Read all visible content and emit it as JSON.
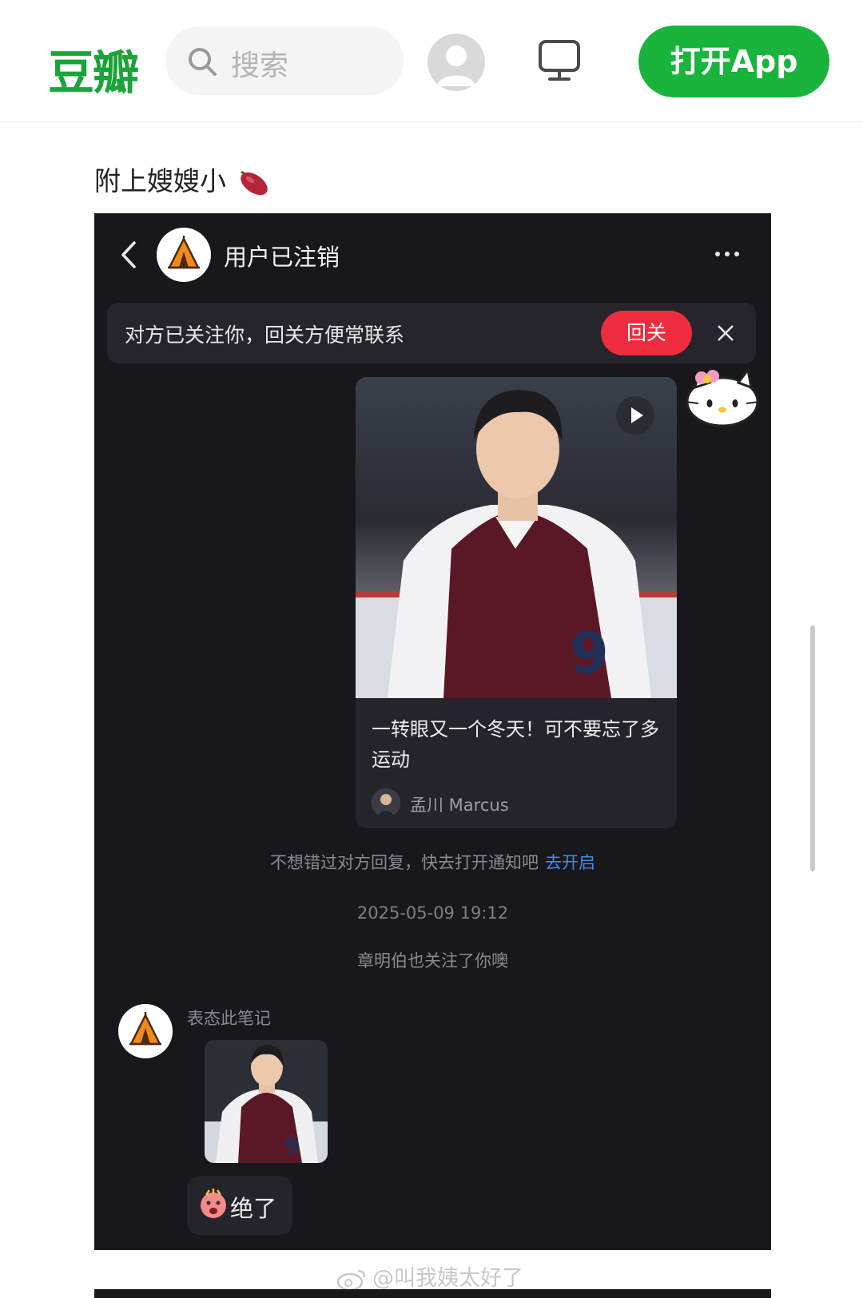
{
  "topbar": {
    "logo": "豆瓣",
    "search_placeholder": "搜索",
    "open_app_label": "打开App",
    "brand_color": "#18b43c"
  },
  "post": {
    "text": "附上嫂嫂小"
  },
  "chat": {
    "user_name": "用户已注销",
    "follow_prompt": "对方已关注你，回关方便常联系",
    "follow_button": "回关",
    "card": {
      "title": "一转眼又一个冬天！可不要忘了多运动",
      "author": "孟川 Marcus"
    },
    "notice": "不想错过对方回复，快去打开通知吧",
    "notice_link": "去开启",
    "timestamp": "2025-05-09 19:12",
    "system_message": "章明伯也关注了你噢",
    "reaction_label": "表态此笔记",
    "reply_text": "绝了"
  },
  "watermark": "@叫我姨太好了"
}
